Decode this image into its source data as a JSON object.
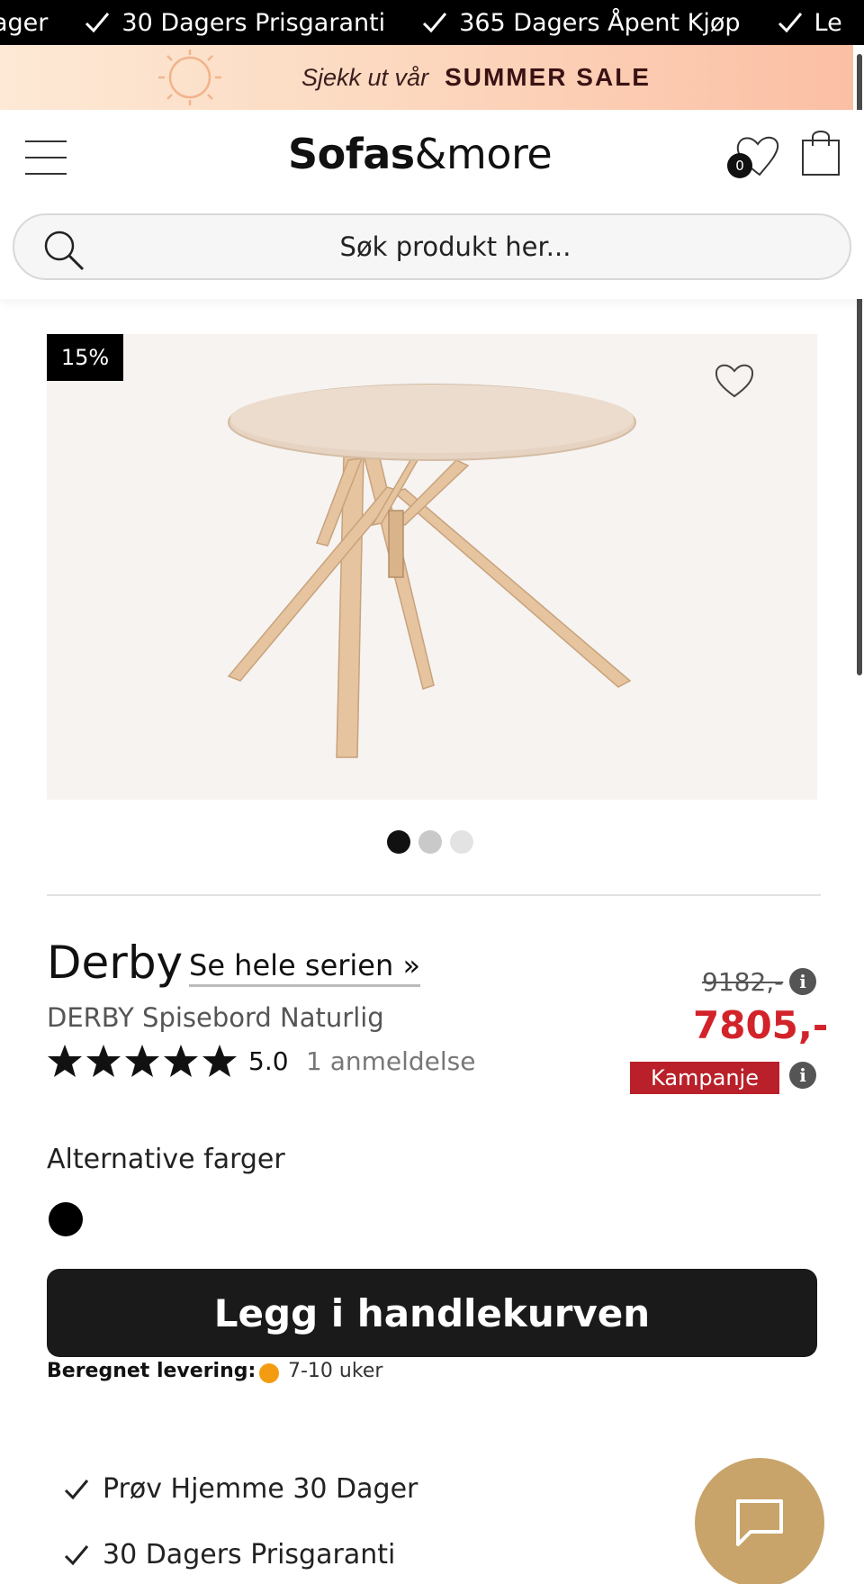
{
  "ticker": {
    "items": [
      "ager",
      "30 Dagers Prisgaranti",
      "365 Dagers Åpent Kjøp",
      "Le"
    ]
  },
  "promo": {
    "lead": "Sjekk ut vår",
    "highlight": "SUMMER SALE"
  },
  "header": {
    "logo_bold": "Sofas",
    "logo_rest": "&more",
    "wishlist_count": "0"
  },
  "search": {
    "placeholder": "Søk produkt her..."
  },
  "gallery": {
    "discount_badge": "15%",
    "dots": [
      {
        "active": true,
        "color": "#111111"
      },
      {
        "active": false,
        "color": "#c9c9c9"
      },
      {
        "active": false,
        "color": "#e3e3e3"
      }
    ]
  },
  "product": {
    "brand": "Derby",
    "series_link": "Se hele serien »",
    "name": "DERBY Spisebord Naturlig",
    "rating": "5.0",
    "rating_stars": 5,
    "review_count": "1 anmeldelse",
    "old_price": "9182,-",
    "new_price": "7805,-",
    "campaign_label": "Kampanje",
    "info_icon": "i"
  },
  "colors": {
    "label": "Alternative farger",
    "swatch": "#000000"
  },
  "cart": {
    "button_label": "Legg i handlekurven"
  },
  "delivery": {
    "label": "Beregnet levering:",
    "value": "7-10 uker",
    "status_color": "#f39c12"
  },
  "usps": [
    "Prøv Hjemme 30 Dager",
    "30 Dagers Prisgaranti"
  ],
  "theme": {
    "accent_red": "#d2232a",
    "campaign_red": "#b9202a",
    "chat_gold": "#c8a46a"
  }
}
